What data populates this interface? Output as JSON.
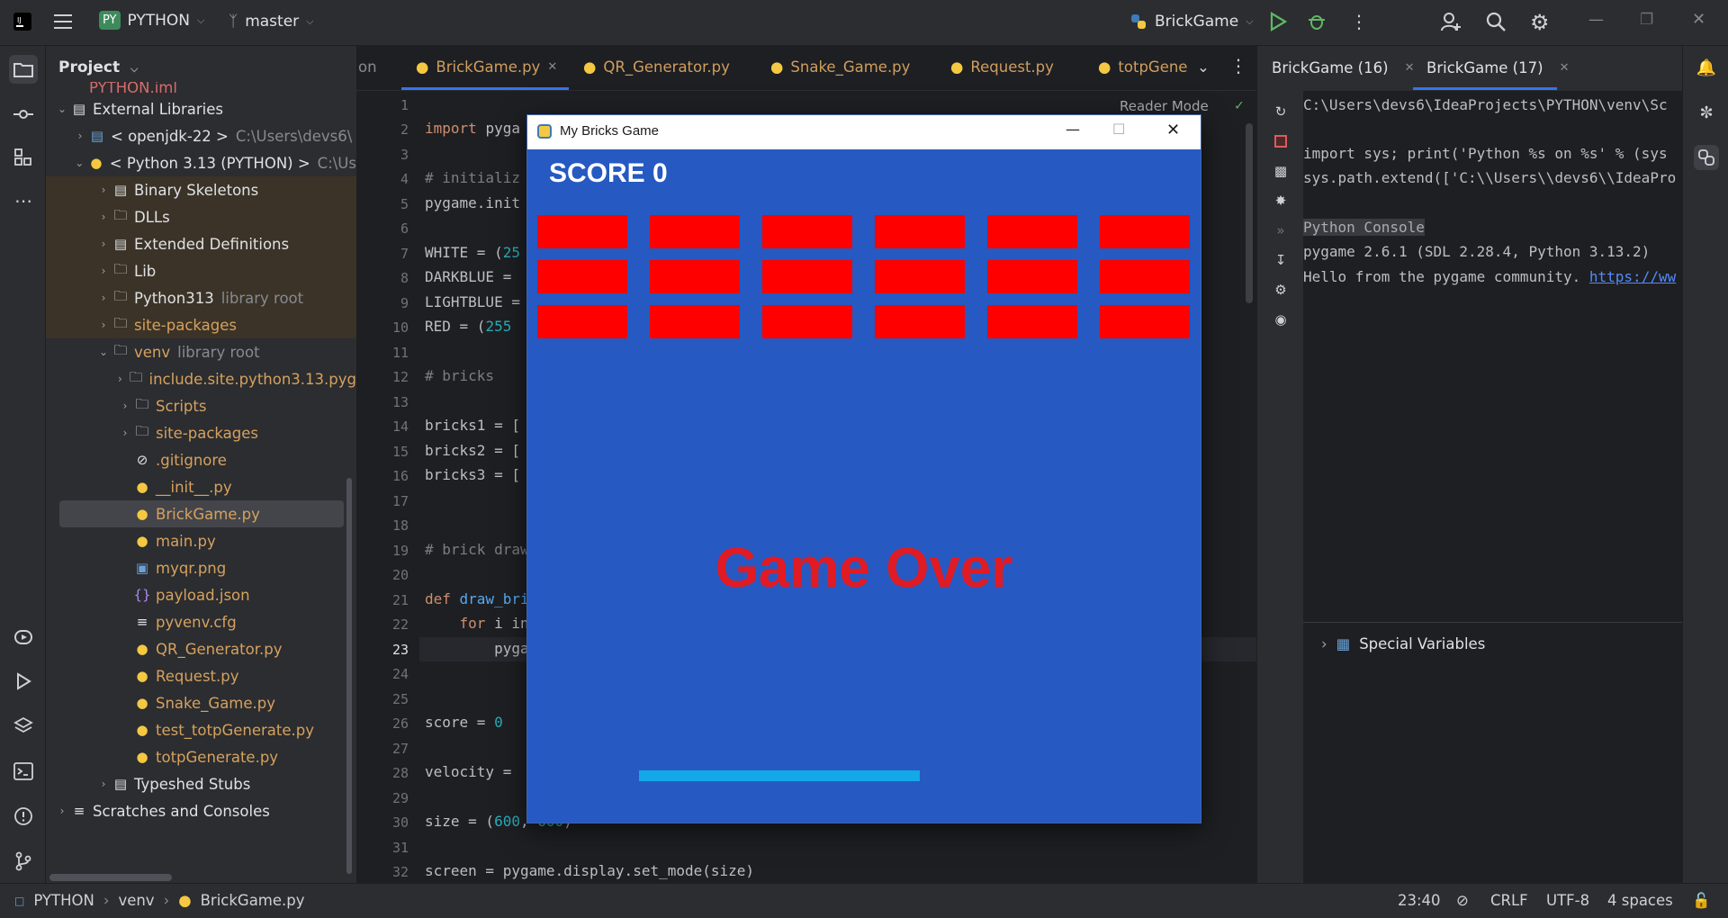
{
  "titlebar": {
    "project_badge": "PY",
    "project_name": "PYTHON",
    "branch": "master",
    "run_config": "BrickGame"
  },
  "project_panel": {
    "title": "Project",
    "tree": [
      {
        "label": "PYTHON.iml",
        "sub": "",
        "icon": "file-icon"
      },
      {
        "label": "External Libraries",
        "sub": "",
        "icon": "library-icon"
      },
      {
        "label": "< openjdk-22 >",
        "sub": "C:\\Users\\devs6\\",
        "icon": "jdk-icon"
      },
      {
        "label": "< Python 3.13 (PYTHON) >",
        "sub": "C:\\Us",
        "icon": "python-icon"
      },
      {
        "label": "Binary Skeletons",
        "sub": "",
        "icon": "library-icon"
      },
      {
        "label": "DLLs",
        "sub": "",
        "icon": "folder-icon"
      },
      {
        "label": "Extended Definitions",
        "sub": "",
        "icon": "library-icon"
      },
      {
        "label": "Lib",
        "sub": "",
        "icon": "folder-icon"
      },
      {
        "label": "Python313",
        "sub": "library root",
        "icon": "folder-icon"
      },
      {
        "label": "site-packages",
        "sub": "",
        "icon": "folder-icon"
      },
      {
        "label": "venv",
        "sub": "library root",
        "icon": "folder-icon"
      },
      {
        "label": "include.site.python3.13.pyg",
        "sub": "",
        "icon": "folder-icon"
      },
      {
        "label": "Scripts",
        "sub": "",
        "icon": "folder-icon"
      },
      {
        "label": "site-packages",
        "sub": "",
        "icon": "folder-icon"
      },
      {
        "label": ".gitignore",
        "sub": "",
        "icon": "ignore-icon"
      },
      {
        "label": "__init__.py",
        "sub": "",
        "icon": "python-file-icon"
      },
      {
        "label": "BrickGame.py",
        "sub": "",
        "icon": "python-file-icon"
      },
      {
        "label": "main.py",
        "sub": "",
        "icon": "python-file-icon"
      },
      {
        "label": "myqr.png",
        "sub": "",
        "icon": "image-icon"
      },
      {
        "label": "payload.json",
        "sub": "",
        "icon": "json-icon"
      },
      {
        "label": "pyvenv.cfg",
        "sub": "",
        "icon": "config-icon"
      },
      {
        "label": "QR_Generator.py",
        "sub": "",
        "icon": "python-file-icon"
      },
      {
        "label": "Request.py",
        "sub": "",
        "icon": "python-file-icon"
      },
      {
        "label": "Snake_Game.py",
        "sub": "",
        "icon": "python-file-icon"
      },
      {
        "label": "test_totpGenerate.py",
        "sub": "",
        "icon": "python-file-icon"
      },
      {
        "label": "totpGenerate.py",
        "sub": "",
        "icon": "python-file-icon"
      },
      {
        "label": "Typeshed Stubs",
        "sub": "",
        "icon": "library-icon"
      },
      {
        "label": "Scratches and Consoles",
        "sub": "",
        "icon": "scratches-icon"
      }
    ]
  },
  "editor": {
    "tabs": [
      "BrickGame.py",
      "QR_Generator.py",
      "Snake_Game.py",
      "Request.py",
      "totpGene"
    ],
    "reader_mode": "Reader Mode",
    "line_numbers": [
      "1",
      "2",
      "3",
      "4",
      "5",
      "6",
      "7",
      "8",
      "9",
      "10",
      "11",
      "12",
      "13",
      "14",
      "15",
      "16",
      "17",
      "18",
      "19",
      "20",
      "21",
      "22",
      "23",
      "24",
      "25",
      "26",
      "27",
      "28",
      "29",
      "30",
      "31",
      "32"
    ],
    "lines": {
      "l2a": "import ",
      "l2b": "pyga",
      "l4": "# initializ",
      "l5": "pygame.init",
      "l7a": "WHITE = (",
      "l7b": "25",
      "l8": "DARKBLUE = ",
      "l9": "LIGHTBLUE =",
      "l10a": "RED = (",
      "l10b": "255",
      "l12": "# bricks",
      "l14": "bricks1 = [",
      "l15": "bricks2 = [",
      "l16": "bricks3 = [",
      "l19": "# brick draw",
      "l21a": "def ",
      "l21b": "draw_bri",
      "l22a": "    for ",
      "l22b": "i in",
      "l23": "        pyga",
      "l26a": "score = ",
      "l26b": "0",
      "l28": "velocity = ",
      "l30a": "size = (",
      "l30b": "600",
      "l30c": ", ",
      "l30d": "600",
      "l30e": ")",
      "l32": "screen = pygame.display.set_mode(size)"
    }
  },
  "console_panel": {
    "tabs": [
      "BrickGame (16)",
      "BrickGame (17)"
    ],
    "lines": [
      "C:\\Users\\devs6\\IdeaProjects\\PYTHON\\venv\\Sc",
      "",
      "import sys; print('Python %s on %s' % (sys",
      "sys.path.extend(['C:\\\\Users\\\\devs6\\\\IdeaPro",
      "",
      "Python Console",
      "pygame 2.6.1 (SDL 2.28.4, Python 3.13.2)",
      "Hello from the pygame community. "
    ],
    "link": "https://ww",
    "special_variables": "Special Variables"
  },
  "pygame_window": {
    "title": "My Bricks Game",
    "score_text": "SCORE 0",
    "game_over_text": "Game Over",
    "brick_rows": 3,
    "brick_cols": 6,
    "colors": {
      "background": "#2659c2",
      "brick": "#ff0000",
      "paddle": "#13a8e8",
      "game_over": "#e01b24"
    }
  },
  "statusbar": {
    "crumbs": [
      "PYTHON",
      "venv",
      "BrickGame.py"
    ],
    "position": "23:40",
    "line_ending": "CRLF",
    "encoding": "UTF-8",
    "indent": "4 spaces"
  }
}
